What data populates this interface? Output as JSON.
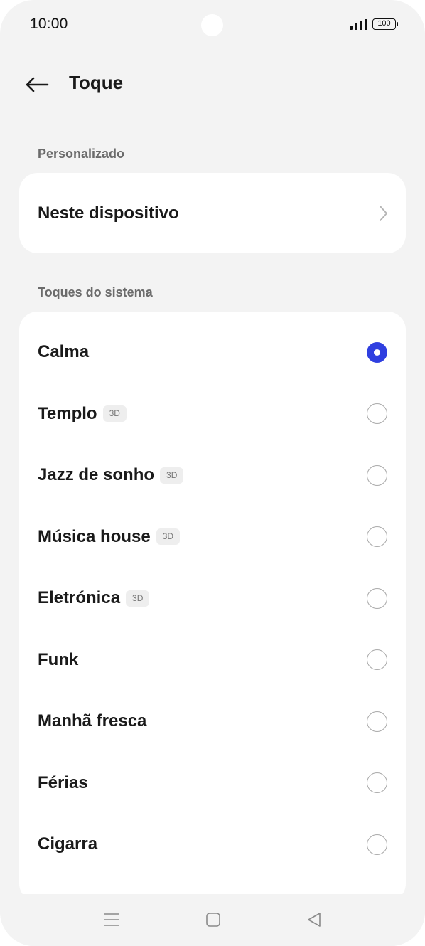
{
  "status_bar": {
    "time": "10:00",
    "battery": "100"
  },
  "header": {
    "title": "Toque",
    "back_icon": "arrow-left-icon"
  },
  "sections": {
    "custom": {
      "title": "Personalizado",
      "item_label": "Neste dispositivo",
      "item_icon": "chevron-right-icon"
    },
    "system": {
      "title": "Toques do sistema",
      "items": [
        {
          "label": "Calma",
          "badge": "",
          "selected": true
        },
        {
          "label": "Templo",
          "badge": "3D",
          "selected": false
        },
        {
          "label": "Jazz de sonho",
          "badge": "3D",
          "selected": false
        },
        {
          "label": "Música house",
          "badge": "3D",
          "selected": false
        },
        {
          "label": "Eletrónica",
          "badge": "3D",
          "selected": false
        },
        {
          "label": "Funk",
          "badge": "",
          "selected": false
        },
        {
          "label": "Manhã fresca",
          "badge": "",
          "selected": false
        },
        {
          "label": "Férias",
          "badge": "",
          "selected": false
        },
        {
          "label": "Cigarra",
          "badge": "",
          "selected": false
        }
      ]
    }
  },
  "nav_bar": {
    "menu_icon": "menu-icon",
    "home_icon": "home-square-icon",
    "back_icon": "back-triangle-icon"
  },
  "colors": {
    "accent": "#2f3fe0",
    "background": "#f3f3f3",
    "card": "#ffffff"
  }
}
